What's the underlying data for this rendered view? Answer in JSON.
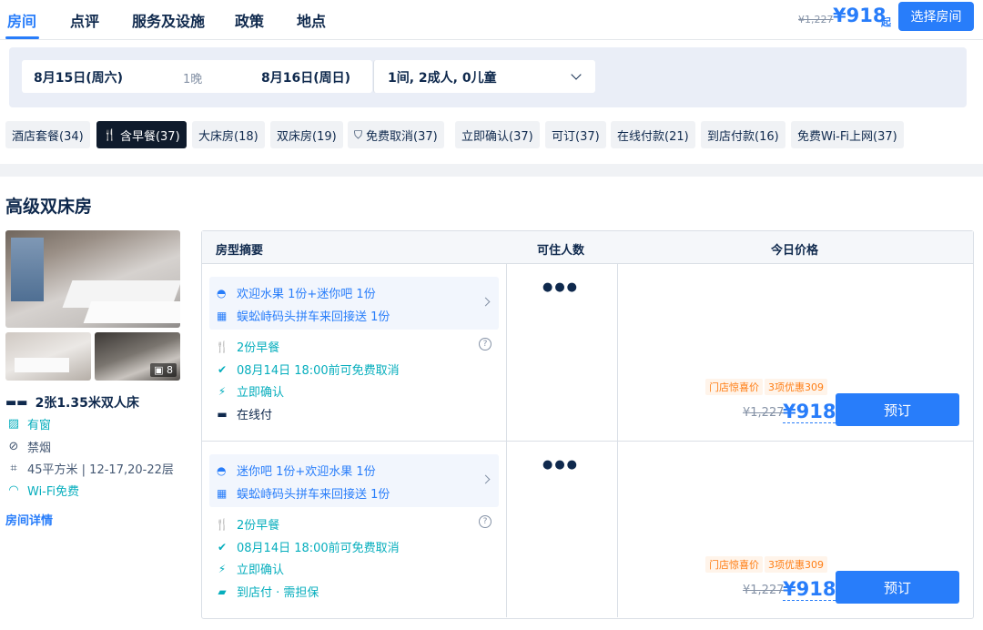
{
  "nav": {
    "tabs": [
      "房间",
      "点评",
      "服务及设施",
      "政策",
      "地点"
    ],
    "original_price": "¥1,227",
    "price": "¥918",
    "price_suffix": "起",
    "choose_button": "选择房间"
  },
  "search": {
    "checkin": "8月15日(周六)",
    "nights": "1晚",
    "checkout": "8月16日(周日)",
    "guests": "1间, 2成人, 0儿童"
  },
  "filters": [
    {
      "label": "酒店套餐(34)",
      "active": false
    },
    {
      "label": "含早餐(37)",
      "active": true,
      "icon": "fork-knife-icon"
    },
    {
      "label": "大床房(18)",
      "active": false
    },
    {
      "label": "双床房(19)",
      "active": false
    },
    {
      "label": "免费取消(37)",
      "active": false,
      "icon": "shield-check-icon"
    },
    {
      "label": "立即确认(37)",
      "active": false
    },
    {
      "label": "可订(37)",
      "active": false
    },
    {
      "label": "在线付款(21)",
      "active": false
    },
    {
      "label": "到店付款(16)",
      "active": false
    },
    {
      "label": "免费Wi-Fi上网(37)",
      "active": false
    }
  ],
  "room": {
    "title": "高级双床房",
    "photo_count": "8",
    "bed": "2张1.35米双人床",
    "window": "有窗",
    "smoking": "禁烟",
    "area": "45平方米 | 12-17,20-22层",
    "wifi": "Wi-Fi免费",
    "details_link": "房间详情"
  },
  "table": {
    "headers": [
      "房型摘要",
      "可住人数",
      "今日价格"
    ],
    "rows": [
      {
        "package_line1": "欢迎水果 1份+迷你吧 1份",
        "package_line2": "蜈蚣峙码头拼车来回接送 1份",
        "breakfast": "2份早餐",
        "cancel": "08月14日 18:00前可免费取消",
        "confirm": "立即确认",
        "payment": "在线付",
        "promo_tag": "门店惊喜价",
        "promo_count": "3项优惠309",
        "original_price": "¥1,227",
        "price": "¥918",
        "book": "预订"
      },
      {
        "package_line1": "迷你吧 1份+欢迎水果 1份",
        "package_line2": "蜈蚣峙码头拼车来回接送 1份",
        "breakfast": "2份早餐",
        "cancel": "08月14日 18:00前可免费取消",
        "confirm": "立即确认",
        "payment": "到店付 · 需担保",
        "promo_tag": "门店惊喜价",
        "promo_count": "3项优惠309",
        "original_price": "¥1,227",
        "price": "¥918",
        "book": "预订"
      }
    ]
  },
  "colors": {
    "accent": "#287dfa",
    "green": "#06aebd",
    "orange": "#ff7d13",
    "dark": "#0f294d"
  }
}
